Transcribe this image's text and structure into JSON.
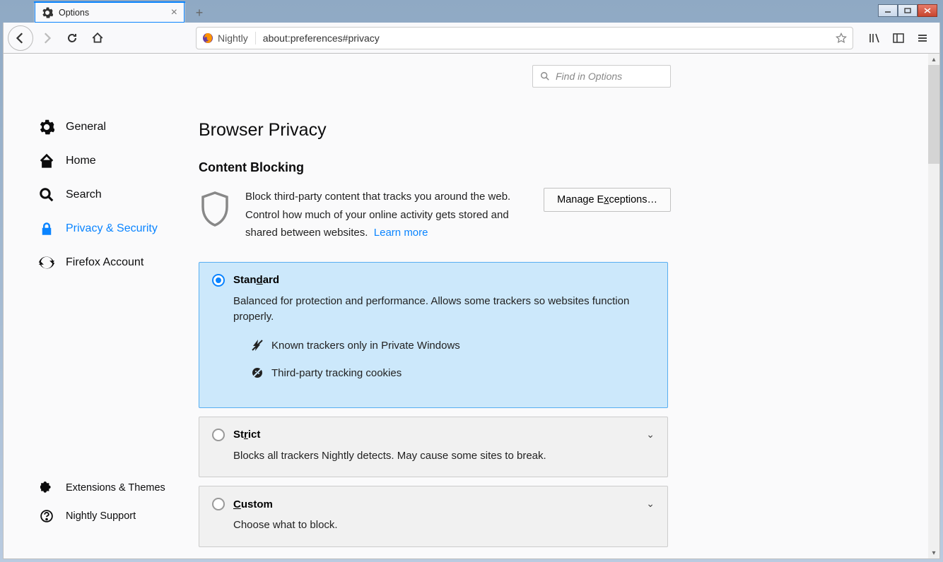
{
  "tab": {
    "title": "Options"
  },
  "url": {
    "brand": "Nightly",
    "address": "about:preferences#privacy"
  },
  "search": {
    "placeholder": "Find in Options"
  },
  "sidebar": {
    "items": [
      {
        "label": "General"
      },
      {
        "label": "Home"
      },
      {
        "label": "Search"
      },
      {
        "label": "Privacy & Security"
      },
      {
        "label": "Firefox Account"
      }
    ],
    "bottom": [
      {
        "label": "Extensions & Themes"
      },
      {
        "label": "Nightly Support"
      }
    ]
  },
  "page": {
    "title": "Browser Privacy",
    "section": "Content Blocking",
    "desc": "Block third-party content that tracks you around the web. Control how much of your online activity gets stored and shared between websites.",
    "learn": "Learn more",
    "manage": "Manage Exceptions…",
    "options": {
      "standard": {
        "title_pre": "Stan",
        "title_u": "d",
        "title_post": "ard",
        "sub": "Balanced for protection and performance. Allows some trackers so websites function properly.",
        "b1": "Known trackers only in Private Windows",
        "b2": "Third-party tracking cookies"
      },
      "strict": {
        "title_pre": "St",
        "title_u": "r",
        "title_post": "ict",
        "sub": "Blocks all trackers Nightly detects. May cause some sites to break."
      },
      "custom": {
        "title_u": "C",
        "title_post": "ustom",
        "sub": "Choose what to block."
      }
    }
  }
}
